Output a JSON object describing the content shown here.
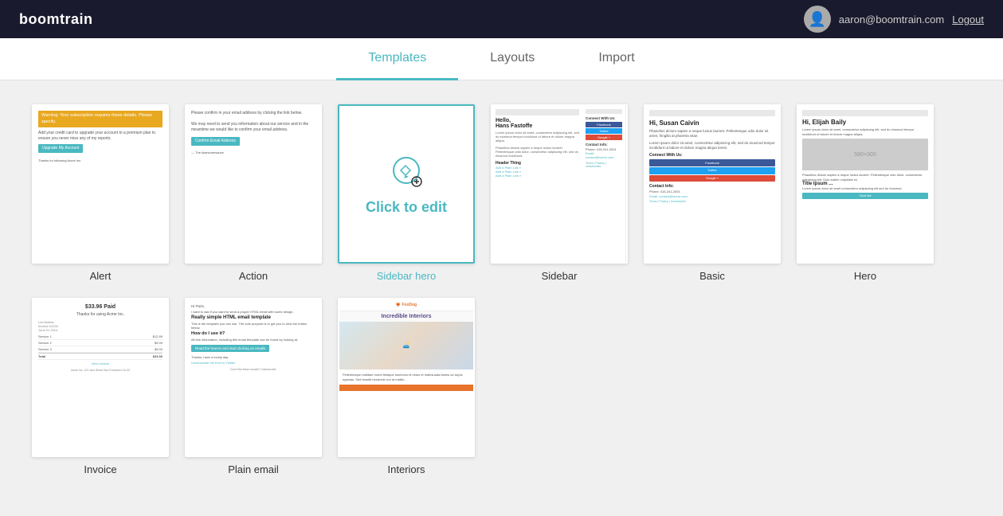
{
  "header": {
    "logo": "boomtrain",
    "user_email": "aaron@boomtrain.com",
    "logout_label": "Logout",
    "avatar_icon": "👤"
  },
  "nav": {
    "tabs": [
      {
        "id": "templates",
        "label": "Templates",
        "active": true
      },
      {
        "id": "layouts",
        "label": "Layouts",
        "active": false
      },
      {
        "id": "import",
        "label": "Import",
        "active": false
      }
    ]
  },
  "templates_row1": [
    {
      "id": "alert",
      "label": "Alert",
      "selected": false
    },
    {
      "id": "action",
      "label": "Action",
      "selected": false
    },
    {
      "id": "sidebar-hero",
      "label": "Sidebar hero",
      "selected": true
    },
    {
      "id": "sidebar",
      "label": "Sidebar",
      "selected": false
    },
    {
      "id": "basic",
      "label": "Basic",
      "selected": false
    },
    {
      "id": "hero",
      "label": "Hero",
      "selected": false
    }
  ],
  "templates_row2": [
    {
      "id": "invoice",
      "label": "Invoice",
      "selected": false
    },
    {
      "id": "plain-email",
      "label": "Plain email",
      "selected": false
    },
    {
      "id": "interiors",
      "label": "Interiors",
      "selected": false
    }
  ],
  "sidebar_hero": {
    "click_to_edit": "Click to edit"
  }
}
